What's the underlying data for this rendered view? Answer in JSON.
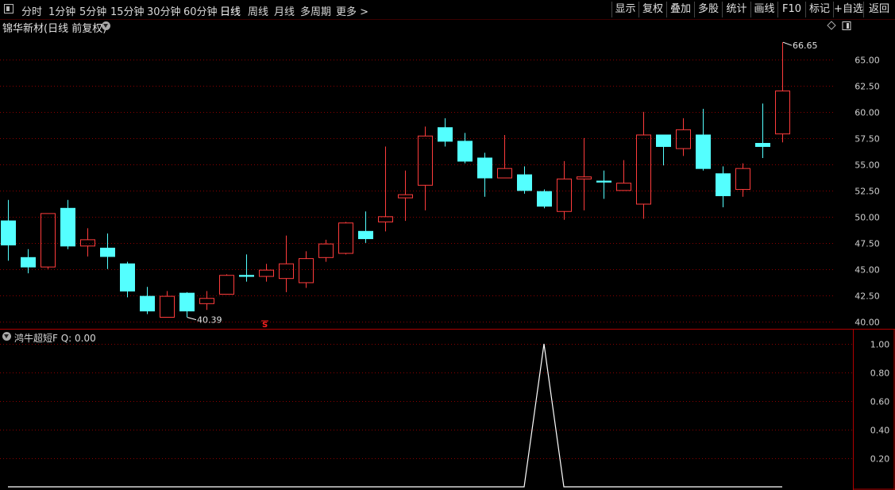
{
  "toolbar": {
    "periods": [
      "分时",
      "1分钟",
      "5分钟",
      "15分钟",
      "30分钟",
      "60分钟",
      "日线",
      "周线",
      "月线",
      "多周期",
      "更多 >"
    ],
    "active_period": "日线",
    "buttons": [
      "显示",
      "复权",
      "叠加",
      "多股",
      "统计",
      "画线",
      "F10",
      "标记",
      "+自选",
      "返回"
    ]
  },
  "stock_title": "锦华新材(日线 前复权)",
  "indicator_title": "鸿牛超短F  Q: 0.00",
  "colors": {
    "up": "#ff3c3c",
    "down": "#54ffff",
    "grid": "#8a0000",
    "indicator_line": "#ffffff",
    "axis_text": "#d0d0d0"
  },
  "markers": {
    "high_label": "66.65",
    "low_label": "40.39",
    "s_marker": "S"
  },
  "chart_data": [
    {
      "type": "candlestick",
      "ylim": [
        39.3,
        67.5
      ],
      "yticks": [
        "65.00",
        "62.50",
        "60.00",
        "57.50",
        "55.00",
        "52.50",
        "50.00",
        "47.50",
        "45.00",
        "42.50",
        "40.00"
      ],
      "candles": [
        {
          "o": 49.6,
          "c": 47.3,
          "h": 51.6,
          "l": 45.8
        },
        {
          "o": 46.1,
          "c": 45.2,
          "h": 46.9,
          "l": 44.6
        },
        {
          "o": 45.2,
          "c": 50.3,
          "h": 50.3,
          "l": 45.0
        },
        {
          "o": 50.8,
          "c": 47.2,
          "h": 51.6,
          "l": 46.9
        },
        {
          "o": 47.2,
          "c": 47.8,
          "h": 48.9,
          "l": 46.2
        },
        {
          "o": 47.0,
          "c": 46.2,
          "h": 48.4,
          "l": 45.0
        },
        {
          "o": 45.5,
          "c": 42.9,
          "h": 45.7,
          "l": 42.3
        },
        {
          "o": 42.4,
          "c": 41.0,
          "h": 43.3,
          "l": 40.7
        },
        {
          "o": 40.4,
          "c": 42.4,
          "h": 42.9,
          "l": 40.4
        },
        {
          "o": 42.7,
          "c": 41.0,
          "h": 42.8,
          "l": 40.39
        },
        {
          "o": 41.7,
          "c": 42.2,
          "h": 42.9,
          "l": 41.1
        },
        {
          "o": 42.6,
          "c": 44.4,
          "h": 44.5,
          "l": 42.6
        },
        {
          "o": 44.4,
          "c": 44.3,
          "h": 46.4,
          "l": 43.8
        },
        {
          "o": 44.3,
          "c": 44.9,
          "h": 45.5,
          "l": 43.8
        },
        {
          "o": 44.1,
          "c": 45.5,
          "h": 48.2,
          "l": 42.8
        },
        {
          "o": 43.7,
          "c": 46.0,
          "h": 46.7,
          "l": 43.2
        },
        {
          "o": 46.1,
          "c": 47.4,
          "h": 47.8,
          "l": 45.7
        },
        {
          "o": 46.5,
          "c": 49.4,
          "h": 49.5,
          "l": 46.4
        },
        {
          "o": 48.6,
          "c": 47.9,
          "h": 50.5,
          "l": 47.5
        },
        {
          "o": 49.5,
          "c": 50.0,
          "h": 56.7,
          "l": 48.6
        },
        {
          "o": 51.8,
          "c": 52.1,
          "h": 54.4,
          "l": 49.6
        },
        {
          "o": 53.0,
          "c": 57.7,
          "h": 58.6,
          "l": 50.6
        },
        {
          "o": 58.5,
          "c": 57.2,
          "h": 59.4,
          "l": 56.7
        },
        {
          "o": 57.2,
          "c": 55.3,
          "h": 58.0,
          "l": 55.1
        },
        {
          "o": 55.6,
          "c": 53.7,
          "h": 56.1,
          "l": 51.9
        },
        {
          "o": 53.7,
          "c": 54.6,
          "h": 57.8,
          "l": 53.7
        },
        {
          "o": 54.0,
          "c": 52.5,
          "h": 54.8,
          "l": 52.2
        },
        {
          "o": 52.4,
          "c": 51.0,
          "h": 52.6,
          "l": 50.8
        },
        {
          "o": 50.5,
          "c": 53.6,
          "h": 55.3,
          "l": 49.7
        },
        {
          "o": 53.6,
          "c": 53.8,
          "h": 57.5,
          "l": 50.6
        },
        {
          "o": 53.4,
          "c": 53.3,
          "h": 54.4,
          "l": 51.7
        },
        {
          "o": 52.5,
          "c": 53.2,
          "h": 55.4,
          "l": 52.5
        },
        {
          "o": 51.2,
          "c": 57.8,
          "h": 60.0,
          "l": 49.8
        },
        {
          "o": 57.8,
          "c": 56.7,
          "h": 57.8,
          "l": 54.9
        },
        {
          "o": 56.5,
          "c": 58.3,
          "h": 59.4,
          "l": 55.8
        },
        {
          "o": 57.8,
          "c": 54.6,
          "h": 60.3,
          "l": 54.4
        },
        {
          "o": 54.1,
          "c": 52.0,
          "h": 54.8,
          "l": 50.9
        },
        {
          "o": 52.6,
          "c": 54.6,
          "h": 55.1,
          "l": 51.9
        },
        {
          "o": 57.0,
          "c": 56.7,
          "h": 60.8,
          "l": 55.6
        },
        {
          "o": 57.9,
          "c": 62.0,
          "h": 66.65,
          "l": 57.1
        }
      ]
    },
    {
      "type": "line",
      "name": "Q",
      "ylim": [
        0,
        1.1
      ],
      "yticks": [
        "1.00",
        "0.80",
        "0.60",
        "0.40",
        "0.20"
      ],
      "values": [
        0,
        0,
        0,
        0,
        0,
        0,
        0,
        0,
        0,
        0,
        0,
        0,
        0,
        0,
        0,
        0,
        0,
        0,
        0,
        0,
        0,
        0,
        0,
        0,
        0,
        0,
        0,
        1,
        0,
        0,
        0,
        0,
        0,
        0,
        0,
        0,
        0,
        0,
        0,
        0
      ]
    }
  ]
}
